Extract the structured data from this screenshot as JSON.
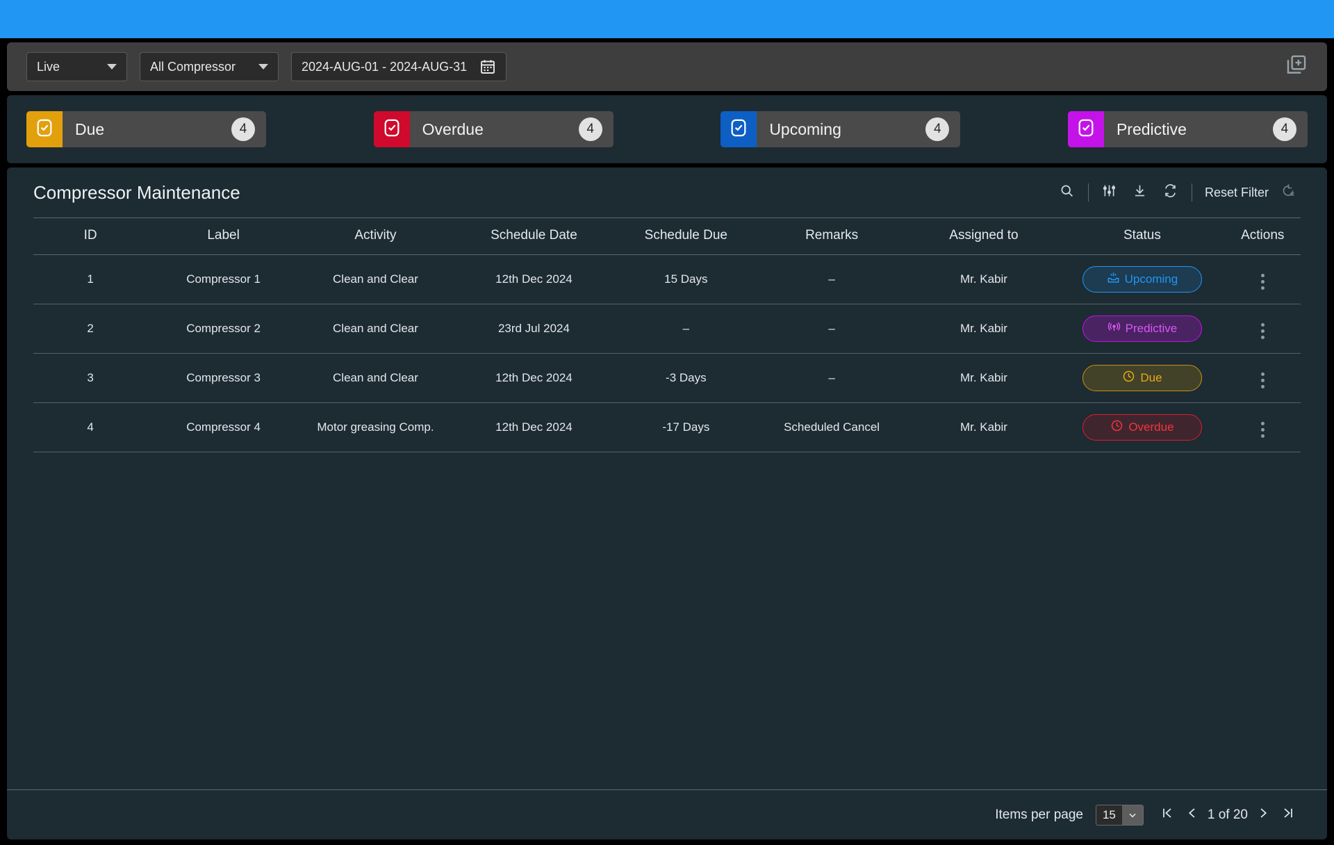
{
  "toolbar": {
    "mode_select": {
      "value": "Live",
      "icon": "chevron-down-icon"
    },
    "asset_select": {
      "value": "All Compressor",
      "icon": "chevron-down-icon"
    },
    "date_range": {
      "value": "2024-AUG-01 - 2024-AUG-31",
      "icon": "calendar-icon"
    },
    "add_button_icon": "add-duplicate-icon"
  },
  "status_cards": [
    {
      "label": "Due",
      "count": "4",
      "color": "#e3a00d",
      "icon": "check-square-icon"
    },
    {
      "label": "Overdue",
      "count": "4",
      "color": "#cf0a2c",
      "icon": "check-square-icon"
    },
    {
      "label": "Upcoming",
      "count": "4",
      "color": "#0d5fc4",
      "icon": "check-square-icon"
    },
    {
      "label": "Predictive",
      "count": "4",
      "color": "#c413e8",
      "icon": "check-square-icon"
    }
  ],
  "panel": {
    "title": "Compressor Maintenance",
    "tools": {
      "search_icon": "search-icon",
      "filter_icon": "filter-sliders-icon",
      "download_icon": "download-icon",
      "refresh_icon": "refresh-icon",
      "reset_filter_label": "Reset Filter",
      "reset_icon": "reset-arrow-icon"
    }
  },
  "table": {
    "columns": [
      "ID",
      "Label",
      "Activity",
      "Schedule Date",
      "Schedule Due",
      "Remarks",
      "Assigned to",
      "Status",
      "Actions"
    ],
    "rows": [
      {
        "id": "1",
        "label": "Compressor 1",
        "activity": "Clean and Clear",
        "schedule_date": "12th Dec 2024",
        "schedule_due": "15 Days",
        "remarks": "–",
        "assigned_to": "Mr. Kabir",
        "status": "Upcoming",
        "status_key": "upcoming",
        "status_icon": "inbox-arrow-icon"
      },
      {
        "id": "2",
        "label": "Compressor 2",
        "activity": "Clean and Clear",
        "schedule_date": "23rd Jul 2024",
        "schedule_due": "–",
        "remarks": "–",
        "assigned_to": "Mr. Kabir",
        "status": "Predictive",
        "status_key": "predictive",
        "status_icon": "signal-broadcast-icon"
      },
      {
        "id": "3",
        "label": "Compressor 3",
        "activity": "Clean and Clear",
        "schedule_date": "12th Dec 2024",
        "schedule_due": "-3 Days",
        "remarks": "–",
        "assigned_to": "Mr. Kabir",
        "status": "Due",
        "status_key": "due",
        "status_icon": "clock-icon"
      },
      {
        "id": "4",
        "label": "Compressor 4",
        "activity": "Motor greasing Comp.",
        "schedule_date": "12th Dec 2024",
        "schedule_due": "-17 Days",
        "remarks": "Scheduled Cancel",
        "assigned_to": "Mr. Kabir",
        "status": "Overdue",
        "status_key": "overdue",
        "status_icon": "clock-icon"
      }
    ],
    "row_action_icon": "kebab-menu-icon"
  },
  "pagination": {
    "items_per_page_label": "Items per page",
    "items_per_page_value": "15",
    "page_indicator": "1 of 20",
    "first_icon": "first-page-icon",
    "prev_icon": "prev-page-icon",
    "next_icon": "next-page-icon",
    "last_icon": "last-page-icon"
  },
  "theme": {
    "top_bar_color": "#2196f3",
    "panel_bg": "#1d2b33",
    "toolbar_bg": "#3e3e3e"
  }
}
